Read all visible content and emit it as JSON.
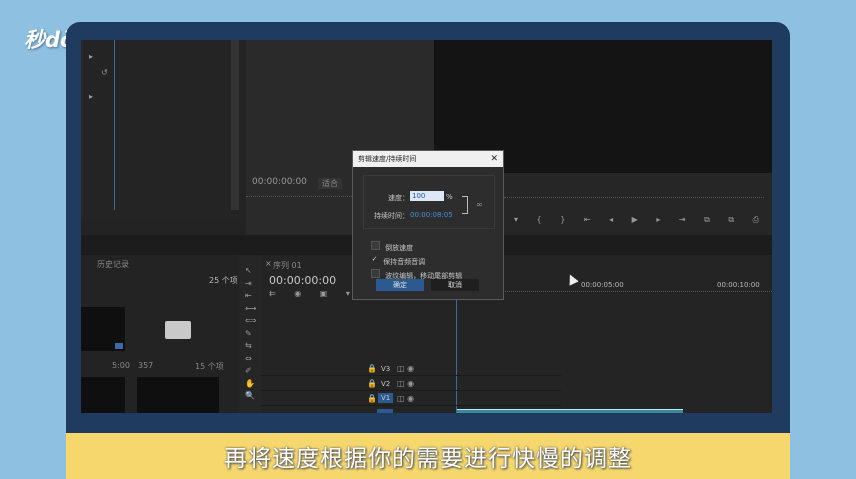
{
  "logo": {
    "text": "秒dōng视频"
  },
  "caption": {
    "text": "再将速度根据你的需要进行快慢的调整"
  },
  "source_monitor": {
    "timecode": "00:00:00:00",
    "zoom": "适合"
  },
  "program_monitor": {
    "timecode": "00:00:05:00",
    "timecode2": "00:00:10:00"
  },
  "project": {
    "tab": "历史记录",
    "count": "25 个项",
    "items": [
      {
        "duration": "5:00"
      },
      {
        "name": "357",
        "count": "15 个项"
      }
    ]
  },
  "timeline": {
    "tab": "序列 01",
    "timecode": "00:00:00:00",
    "tracks": [
      "V3",
      "V2",
      "V1"
    ]
  },
  "dialog": {
    "title": "剪辑速度/持续时间",
    "speed_label": "速度：",
    "speed_value": "100",
    "speed_unit": "%",
    "duration_label": "持续时间：",
    "duration_value": "00:00:08:05",
    "options": [
      {
        "label": "倒放速度",
        "checked": false
      },
      {
        "label": "保持音频音调",
        "checked": true
      },
      {
        "label": "波纹编辑，移动尾部剪辑",
        "checked": false
      }
    ],
    "ok_label": "确定",
    "cancel_label": "取消"
  },
  "colors": {
    "background": "#8ec0e2",
    "frame": "#1f3b5f",
    "caption_bg": "#f5d76e",
    "accent": "#2a5a8f"
  }
}
